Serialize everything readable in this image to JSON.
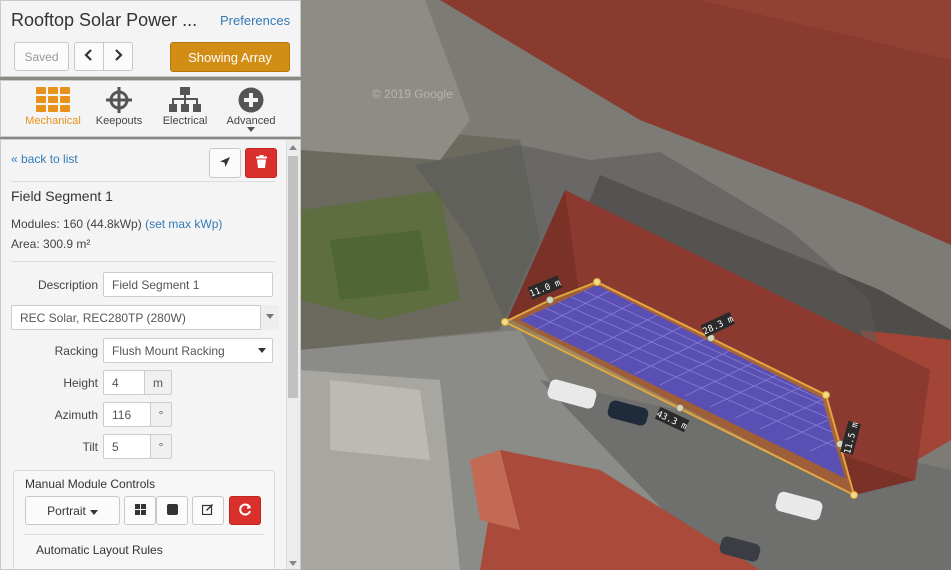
{
  "project": {
    "title": "Rooftop Solar Power ...",
    "preferences_label": "Preferences"
  },
  "toolbar": {
    "saved_label": "Saved",
    "prev_icon": "chevron-left-icon",
    "next_icon": "chevron-right-icon",
    "show_array_label": "Showing Array"
  },
  "tabs": [
    {
      "label": "Mechanical",
      "icon": "grid-icon",
      "active": true
    },
    {
      "label": "Keepouts",
      "icon": "crosshair-icon",
      "active": false
    },
    {
      "label": "Electrical",
      "icon": "hierarchy-icon",
      "active": false
    },
    {
      "label": "Advanced",
      "icon": "plus-circle-icon",
      "active": false
    }
  ],
  "segment": {
    "back_label": "« back to list",
    "name": "Field Segment 1",
    "modules_text": "Modules: 160 (44.8kWp)",
    "set_max_label": "(set max kWp)",
    "area_text": "Area: 300.9 m²"
  },
  "form": {
    "description_label": "Description",
    "description_value": "Field Segment 1",
    "module_value": "REC Solar, REC280TP (280W)",
    "racking_label": "Racking",
    "racking_value": "Flush Mount Racking",
    "height_label": "Height",
    "height_value": "4",
    "height_unit": "m",
    "azimuth_label": "Azimuth",
    "azimuth_value": "116",
    "azimuth_unit": "°",
    "tilt_label": "Tilt",
    "tilt_value": "5",
    "tilt_unit": "°"
  },
  "manual_controls": {
    "title": "Manual Module Controls",
    "orientation_label": "Portrait",
    "auto_rules_label": "Automatic Layout Rules"
  },
  "map": {
    "watermark": "© 2019 Google",
    "dimensions": [
      "11.0 m",
      "28.3 m",
      "43.3 m",
      "11.5 m"
    ]
  },
  "colors": {
    "accent": "#e8921c",
    "show_array": "#d28d14",
    "danger": "#d9302b",
    "link": "#337ab7",
    "module_fill": "#5a4fb3"
  }
}
